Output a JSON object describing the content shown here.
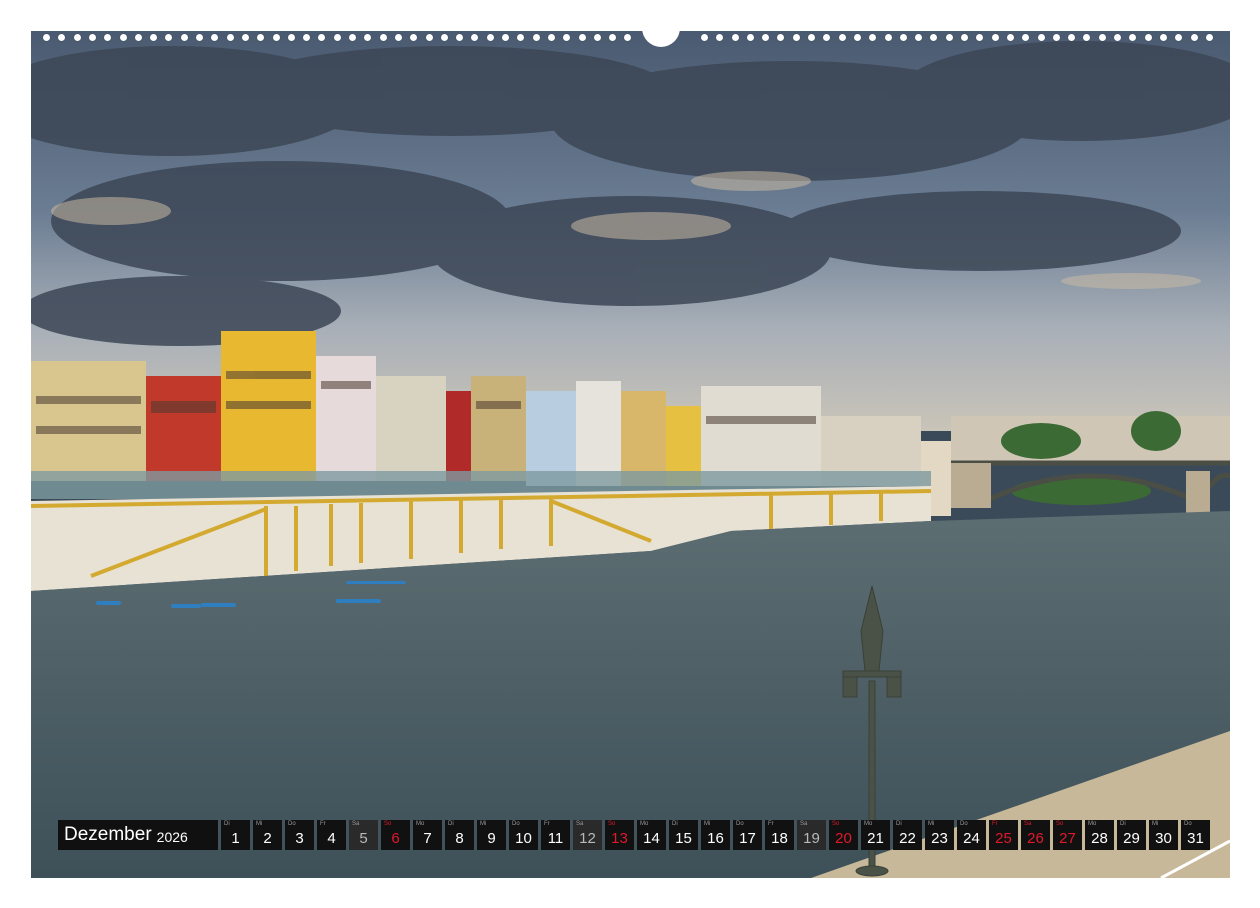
{
  "calendar": {
    "month": "Dezember",
    "year": "2026",
    "days": [
      {
        "wd": "Di",
        "num": "1",
        "type": "week"
      },
      {
        "wd": "Mi",
        "num": "2",
        "type": "week"
      },
      {
        "wd": "Do",
        "num": "3",
        "type": "week"
      },
      {
        "wd": "Fr",
        "num": "4",
        "type": "week"
      },
      {
        "wd": "Sa",
        "num": "5",
        "type": "sat"
      },
      {
        "wd": "So",
        "num": "6",
        "type": "sun"
      },
      {
        "wd": "Mo",
        "num": "7",
        "type": "week"
      },
      {
        "wd": "Di",
        "num": "8",
        "type": "week"
      },
      {
        "wd": "Mi",
        "num": "9",
        "type": "week"
      },
      {
        "wd": "Do",
        "num": "10",
        "type": "week"
      },
      {
        "wd": "Fr",
        "num": "11",
        "type": "week"
      },
      {
        "wd": "Sa",
        "num": "12",
        "type": "sat"
      },
      {
        "wd": "So",
        "num": "13",
        "type": "sun"
      },
      {
        "wd": "Mo",
        "num": "14",
        "type": "week"
      },
      {
        "wd": "Di",
        "num": "15",
        "type": "week"
      },
      {
        "wd": "Mi",
        "num": "16",
        "type": "week"
      },
      {
        "wd": "Do",
        "num": "17",
        "type": "week"
      },
      {
        "wd": "Fr",
        "num": "18",
        "type": "week"
      },
      {
        "wd": "Sa",
        "num": "19",
        "type": "sat"
      },
      {
        "wd": "So",
        "num": "20",
        "type": "sun"
      },
      {
        "wd": "Mo",
        "num": "21",
        "type": "week"
      },
      {
        "wd": "Di",
        "num": "22",
        "type": "week"
      },
      {
        "wd": "Mi",
        "num": "23",
        "type": "week"
      },
      {
        "wd": "Do",
        "num": "24",
        "type": "week"
      },
      {
        "wd": "Fr",
        "num": "25",
        "type": "hol"
      },
      {
        "wd": "Sa",
        "num": "26",
        "type": "hol"
      },
      {
        "wd": "So",
        "num": "27",
        "type": "sun"
      },
      {
        "wd": "Mo",
        "num": "28",
        "type": "week"
      },
      {
        "wd": "Di",
        "num": "29",
        "type": "week"
      },
      {
        "wd": "Mi",
        "num": "30",
        "type": "week"
      },
      {
        "wd": "Do",
        "num": "31",
        "type": "week"
      }
    ]
  },
  "colors": {
    "weekday_text": "#ffffff",
    "sunday_holiday_text": "#e0192d",
    "saturday_text": "#b9b9b9",
    "bar_background": "#111111"
  }
}
